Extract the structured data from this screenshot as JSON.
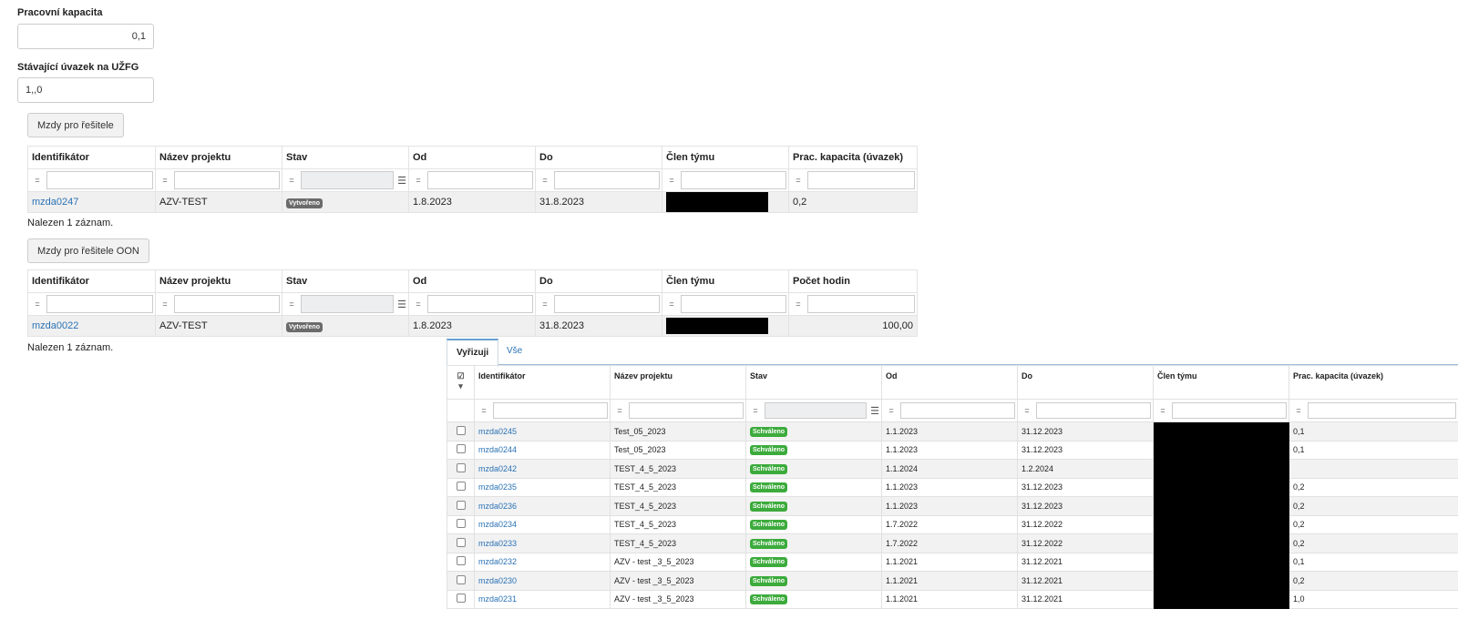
{
  "form": {
    "capacity_label": "Pracovní kapacita",
    "capacity_value": "0,1",
    "current_label": "Stávající úvazek na UŽFG",
    "current_value": "1,,0"
  },
  "section1": {
    "button": "Mzdy pro řešitele",
    "headers": [
      "Identifikátor",
      "Název projektu",
      "Stav",
      "Od",
      "Do",
      "Člen týmu",
      "Prac. kapacita (úvazek)"
    ],
    "filter_op": "=",
    "row": {
      "id": "mzda0247",
      "project": "AZV-TEST",
      "status": "Vytvořeno",
      "from": "1.8.2023",
      "to": "31.8.2023",
      "capacity": "0,2"
    },
    "count": "Nalezen 1 záznam."
  },
  "section2": {
    "button": "Mzdy pro řešitele OON",
    "headers": [
      "Identifikátor",
      "Název projektu",
      "Stav",
      "Od",
      "Do",
      "Člen týmu",
      "Počet hodin"
    ],
    "row": {
      "id": "mzda0022",
      "project": "AZV-TEST",
      "status": "Vytvořeno",
      "from": "1.8.2023",
      "to": "31.8.2023",
      "hours": "100,00"
    },
    "count": "Nalezen 1 záznam."
  },
  "panel": {
    "tabs": [
      "Vyřizuji",
      "Vše"
    ],
    "headers": [
      "Identifikátor",
      "Název projektu",
      "Stav",
      "Od",
      "Do",
      "Člen týmu",
      "Prac. kapacita (úvazek)"
    ],
    "rows": [
      {
        "id": "mzda0245",
        "project": "Test_05_2023",
        "status": "Schváleno",
        "from": "1.1.2023",
        "to": "31.12.2023",
        "capacity": "0,1"
      },
      {
        "id": "mzda0244",
        "project": "Test_05_2023",
        "status": "Schváleno",
        "from": "1.1.2023",
        "to": "31.12.2023",
        "capacity": "0,1"
      },
      {
        "id": "mzda0242",
        "project": "TEST_4_5_2023",
        "status": "Schváleno",
        "from": "1.1.2024",
        "to": "1.2.2024",
        "capacity": ""
      },
      {
        "id": "mzda0235",
        "project": "TEST_4_5_2023",
        "status": "Schváleno",
        "from": "1.1.2023",
        "to": "31.12.2023",
        "capacity": "0,2"
      },
      {
        "id": "mzda0236",
        "project": "TEST_4_5_2023",
        "status": "Schváleno",
        "from": "1.1.2023",
        "to": "31.12.2023",
        "capacity": "0,2"
      },
      {
        "id": "mzda0234",
        "project": "TEST_4_5_2023",
        "status": "Schváleno",
        "from": "1.7.2022",
        "to": "31.12.2022",
        "capacity": "0,2"
      },
      {
        "id": "mzda0233",
        "project": "TEST_4_5_2023",
        "status": "Schváleno",
        "from": "1.7.2022",
        "to": "31.12.2022",
        "capacity": "0,2"
      },
      {
        "id": "mzda0232",
        "project": "AZV - test _3_5_2023",
        "status": "Schváleno",
        "from": "1.1.2021",
        "to": "31.12.2021",
        "capacity": "0,1"
      },
      {
        "id": "mzda0230",
        "project": "AZV - test _3_5_2023",
        "status": "Schváleno",
        "from": "1.1.2021",
        "to": "31.12.2021",
        "capacity": "0,2"
      },
      {
        "id": "mzda0231",
        "project": "AZV - test _3_5_2023",
        "status": "Schváleno",
        "from": "1.1.2021",
        "to": "31.12.2021",
        "capacity": "1,0"
      }
    ]
  }
}
